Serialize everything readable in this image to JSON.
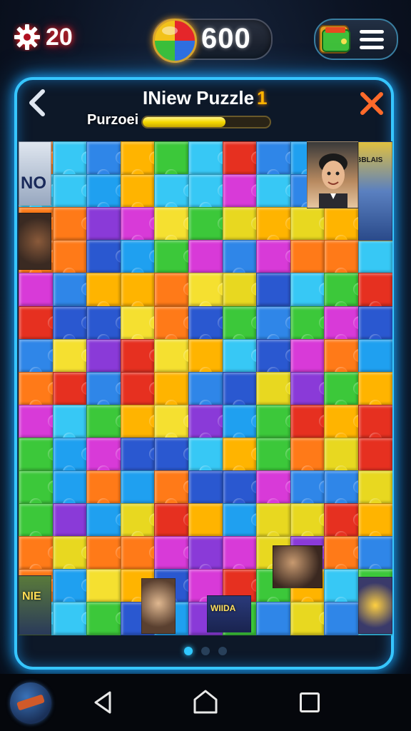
{
  "hud": {
    "gear_count": "20",
    "coins": "600",
    "icons": {
      "settings": "gear-icon",
      "currency": "orb-icon",
      "shop": "wallet-icon",
      "menu": "menu-icon"
    }
  },
  "header": {
    "title": "INiew Puzzle",
    "title_badge": "1",
    "progress_label": "Purzoei",
    "progress_fraction": 0.65,
    "back_icon": "chevron-left-icon",
    "close_icon": "close-icon"
  },
  "board": {
    "photo_text_1": "NO",
    "photo_text_2": "LBBLAIS",
    "photo_text_3": "WIIDA",
    "photo_text_4": "NIE"
  },
  "pagination": {
    "pages": 3,
    "active": 0
  },
  "navbar": {
    "icons": [
      "app-thumbnail-icon",
      "nav-back-icon",
      "nav-home-icon",
      "nav-recent-icon"
    ]
  },
  "colors": {
    "accent_glow": "#36c6ff",
    "gear_glow": "#ff2a2a",
    "progress_fill": "#f5d800",
    "close_x": "#ff6a2a"
  }
}
